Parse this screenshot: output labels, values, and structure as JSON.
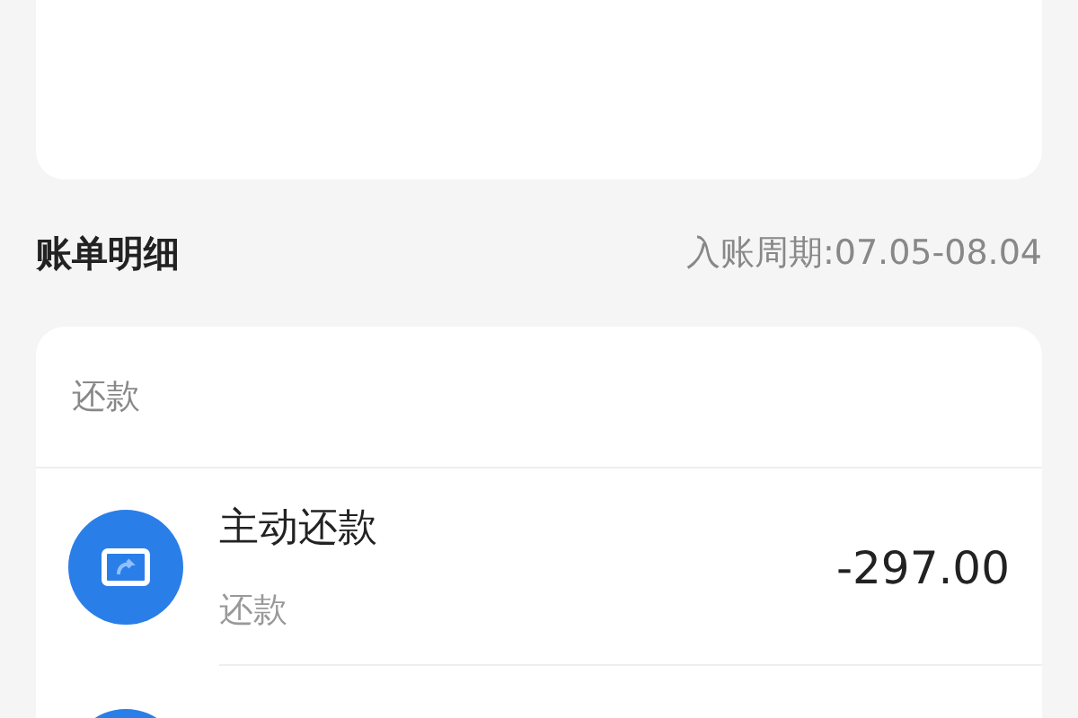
{
  "bill_details": {
    "title": "账单明细",
    "period": "入账周期:07.05-08.04",
    "section": "还款",
    "items": [
      {
        "title": "主动还款",
        "subtitle": "还款",
        "amount": "-297.00"
      }
    ]
  }
}
